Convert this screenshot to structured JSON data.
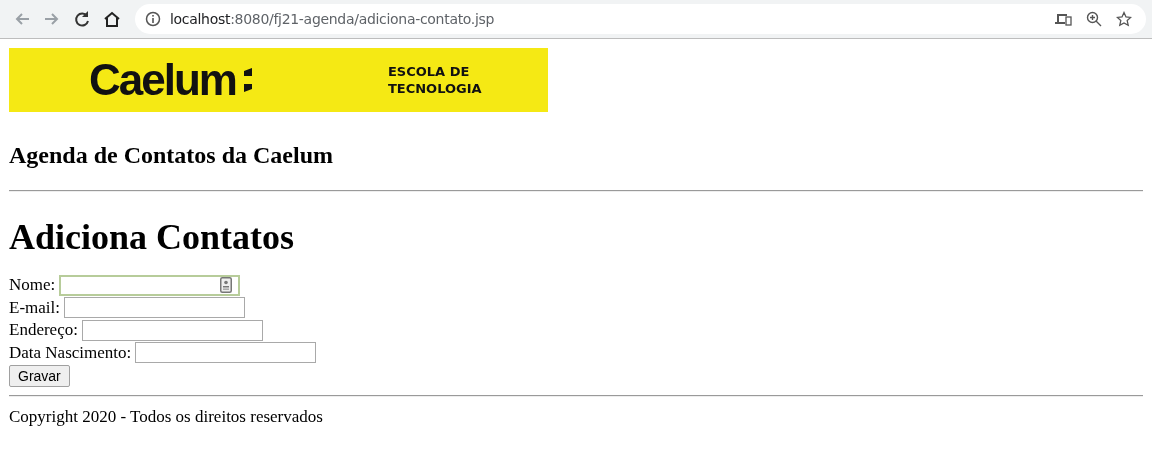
{
  "browser": {
    "url_host": "localhost",
    "url_path": ":8080/fj21-agenda/adiciona-contato.jsp"
  },
  "logo": {
    "brand": "Caelum",
    "tagline_1": "ESCOLA DE",
    "tagline_2": "TECNOLOGIA"
  },
  "site_title": "Agenda de Contatos da Caelum",
  "page_title": "Adiciona Contatos",
  "fields": [
    {
      "label": "Nome:",
      "focused": true
    },
    {
      "label": "E-mail:",
      "focused": false
    },
    {
      "label": "Endereço:",
      "focused": false
    },
    {
      "label": "Data Nascimento:",
      "focused": false
    }
  ],
  "submit": "Gravar",
  "footer": "Copyright 2020 - Todos os direitos reservados"
}
